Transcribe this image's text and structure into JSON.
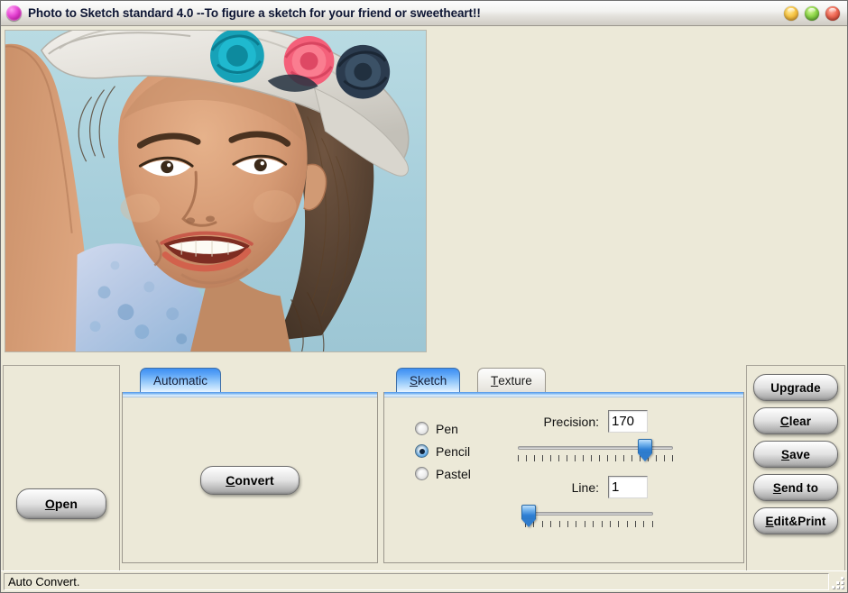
{
  "window": {
    "title": "Photo to Sketch standard 4.0 --To figure a sketch for your friend or sweetheart!!",
    "icon": "app-circle-icon",
    "buttons": {
      "minimize": "minimize-button",
      "maximize": "maximize-button",
      "close": "close-button"
    }
  },
  "photo": {
    "alt": "Portrait photograph of a smiling young woman wearing a white hat decorated with teal, pink and navy fabric flowers, against a light blue studio background",
    "background_color": "#a8cfd9"
  },
  "left_panel": {
    "open_label": "Open",
    "open_accel": "O"
  },
  "automatic_group": {
    "tabs": [
      {
        "label": "Automatic",
        "active": true
      }
    ],
    "convert_label": "Convert",
    "convert_accel": "C"
  },
  "sketch_group": {
    "tabs": [
      {
        "label": "Sketch",
        "accel": "S",
        "active": true
      },
      {
        "label": "Texture",
        "accel": "T",
        "active": false
      }
    ],
    "styles": [
      {
        "label": "Pen",
        "selected": false
      },
      {
        "label": "Pencil",
        "selected": true
      },
      {
        "label": "Pastel",
        "selected": false
      }
    ],
    "precision": {
      "label": "Precision:",
      "value": "170",
      "slider_percent": 82,
      "tick_count": 20
    },
    "line": {
      "label": "Line:",
      "value": "1",
      "slider_percent": 3,
      "tick_count": 16
    }
  },
  "right_panel": {
    "buttons": [
      {
        "label": "Upgrade",
        "accel": ""
      },
      {
        "label": "Clear",
        "accel": "C"
      },
      {
        "label": "Save",
        "accel": "S"
      },
      {
        "label": "Send to",
        "accel": "S"
      },
      {
        "label": "Edit&Print",
        "accel": "E"
      }
    ]
  },
  "statusbar": {
    "text": "Auto Convert."
  },
  "colors": {
    "tab_active": "#4e9af0",
    "accent_blue": "#2f7ccd",
    "face_gray": "#ece9d8",
    "title_text": "#0d1533"
  }
}
